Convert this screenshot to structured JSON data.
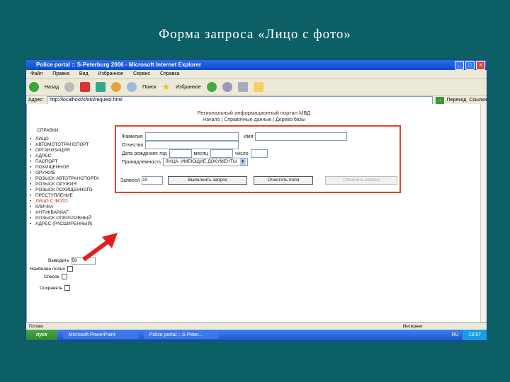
{
  "slide": {
    "title": "Форма запроса «Лицо с фото»"
  },
  "window": {
    "title": "Police portal :: S-Peterburg 2006 - Microsoft Internet Explorer"
  },
  "menu": [
    "Файл",
    "Правка",
    "Вид",
    "Избранное",
    "Сервис",
    "Справка"
  ],
  "toolbar": {
    "back": "Назад",
    "search": "Поиск",
    "favorites": "Избранное"
  },
  "address": {
    "label": "Адрес:",
    "url": "http://localhost/sfoto/request.html",
    "go": "Переход",
    "links": "Ссылки"
  },
  "page": {
    "portal_title": "Региональный информационный портал МВД",
    "nav": "Начало  |  Справочные данные  |  Дерево базы",
    "sidebar": {
      "header": "СПРАВКИ:",
      "items": [
        "ЛИЦО",
        "АВТОМОТОТРАНСПОРТ",
        "ОРГАНИЗАЦИЯ",
        "АДРЕС",
        "ПАСПОРТ",
        "ПОХИЩЕННОЕ",
        "ОРУЖИЕ",
        "РОЗЫСК АВТОТРАНСПОРТА",
        "РОЗЫСК ОРУЖИЯ",
        "РОЗЫСК ПОХИЩЕННОГО",
        "ПРЕСТУПЛЕНИЕ",
        "ЛИЦО С ФОТО",
        "КЛИЧКА",
        "АНТИКВАРИАТ",
        "РОЗЫСК ОПЕРАТИВНЫЙ",
        "АДРЕС (РАСШИРЕННЫЙ)"
      ],
      "active_index": 11
    },
    "options": {
      "output_label": "Выводить",
      "output_value": "50",
      "opt1": "Наиболее полно",
      "opt2": "Список",
      "opt3": "Сохранять"
    },
    "form": {
      "surname_label": "Фамилия",
      "name_label": "Имя",
      "patronymic_label": "Отчество",
      "dob_label": "Дата рождения: год",
      "month_label": "месяц",
      "day_label": "число",
      "belongs_label": "Принадлежность",
      "belongs_value": "ЛИЦА, ИМЕЮЩИЕ ДОКУМЕНТЫ",
      "records_label": "Записей",
      "records_value": "10",
      "submit": "Выполнить запрос",
      "clear": "Очистить поля",
      "cancel": "Отменить запрос"
    }
  },
  "status": {
    "text": "Готово",
    "zone": "Интернет"
  },
  "taskbar": {
    "start": "пуск",
    "tasks": [
      "Microsoft PowerPoint",
      "Police portal :: S-Peter..."
    ],
    "lang": "RU",
    "time": "13:57"
  }
}
